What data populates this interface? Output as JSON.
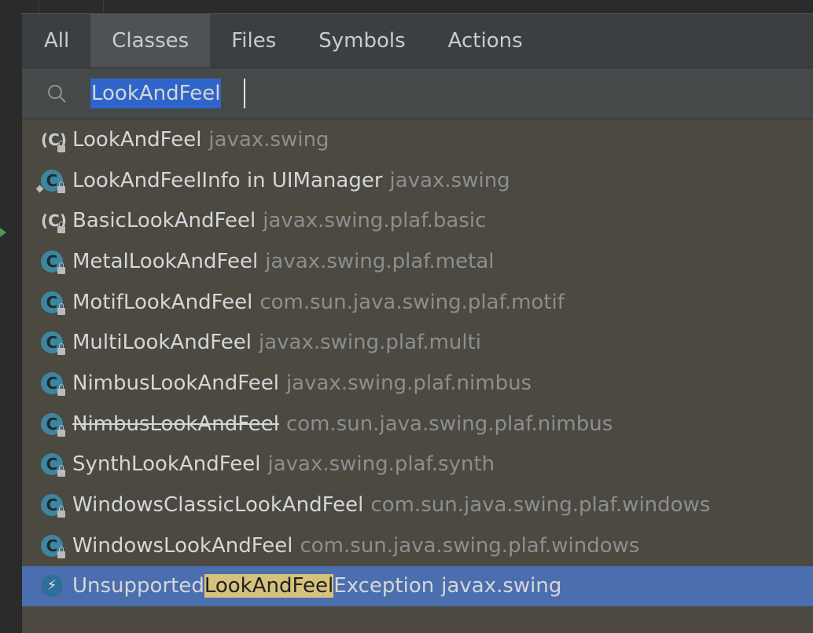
{
  "tabs": [
    {
      "label": "All",
      "active": false
    },
    {
      "label": "Classes",
      "active": true
    },
    {
      "label": "Files",
      "active": false
    },
    {
      "label": "Symbols",
      "active": false
    },
    {
      "label": "Actions",
      "active": false
    }
  ],
  "search": {
    "value": "LookAndFeel",
    "icon": "search-icon"
  },
  "results": [
    {
      "name": "LookAndFeel",
      "package": "javax.swing",
      "icon": "abstract-class-icon"
    },
    {
      "name": "LookAndFeelInfo in UIManager",
      "package": "javax.swing",
      "icon": "inner-class-icon"
    },
    {
      "name": "BasicLookAndFeel",
      "package": "javax.swing.plaf.basic",
      "icon": "abstract-class-icon"
    },
    {
      "name": "MetalLookAndFeel",
      "package": "javax.swing.plaf.metal",
      "icon": "class-icon"
    },
    {
      "name": "MotifLookAndFeel",
      "package": "com.sun.java.swing.plaf.motif",
      "icon": "class-icon"
    },
    {
      "name": "MultiLookAndFeel",
      "package": "javax.swing.plaf.multi",
      "icon": "class-icon"
    },
    {
      "name": "NimbusLookAndFeel",
      "package": "javax.swing.plaf.nimbus",
      "icon": "class-icon"
    },
    {
      "name": "NimbusLookAndFeel",
      "package": "com.sun.java.swing.plaf.nimbus",
      "icon": "class-icon",
      "deprecated": true
    },
    {
      "name": "SynthLookAndFeel",
      "package": "javax.swing.plaf.synth",
      "icon": "class-icon"
    },
    {
      "name": "WindowsClassicLookAndFeel",
      "package": "com.sun.java.swing.plaf.windows",
      "icon": "class-icon"
    },
    {
      "name": "WindowsLookAndFeel",
      "package": "com.sun.java.swing.plaf.windows",
      "icon": "class-icon"
    },
    {
      "name_prefix": "Unsupported",
      "name_match": "LookAndFeel",
      "name_suffix": "Exception",
      "package": "javax.swing",
      "icon": "exception-class-icon",
      "selected": true
    }
  ],
  "colors": {
    "selection": "#4b6eaf",
    "match_highlight": "#d6c27c",
    "popup_bg": "#4b4940"
  }
}
